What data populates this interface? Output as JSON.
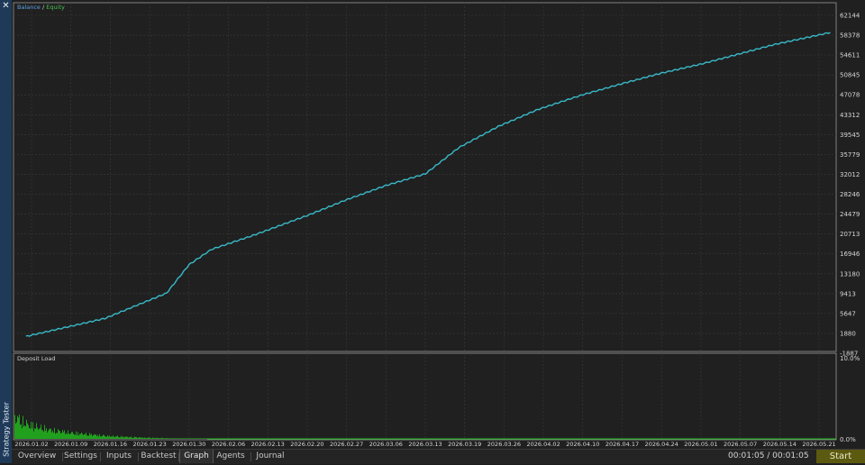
{
  "window": {
    "side_title": "Strategy Tester",
    "close_glyph": "✕"
  },
  "legend": {
    "balance": "Balance",
    "separator": " / ",
    "equity": "Equity"
  },
  "deposit_load": {
    "title": "Deposit Load"
  },
  "tabs": [
    {
      "label": "Overview",
      "active": false
    },
    {
      "label": "Settings",
      "active": false
    },
    {
      "label": "Inputs",
      "active": false
    },
    {
      "label": "Backtest",
      "active": false
    },
    {
      "label": "Graph",
      "active": true
    },
    {
      "label": "Agents",
      "active": false
    },
    {
      "label": "Journal",
      "active": false
    }
  ],
  "timer": "00:01:05 / 00:01:05",
  "start_label": "Start",
  "colors": {
    "balance_line": "#39b9c8",
    "equity_legend": "#49c24f",
    "deposit_bars": "#22c01e",
    "start_button": "#5b5a10"
  },
  "chart_data": [
    {
      "type": "line",
      "series": [
        {
          "name": "Balance",
          "x": [
            "2026-01-01",
            "2026-01-15",
            "2026-01-26",
            "2026-01-30",
            "2026-02-03",
            "2026-02-10",
            "2026-02-20",
            "2026-02-27",
            "2026-03-06",
            "2026-03-13",
            "2026-03-19",
            "2026-03-26",
            "2026-04-02",
            "2026-04-10",
            "2026-04-17",
            "2026-04-24",
            "2026-05-01",
            "2026-05-07",
            "2026-05-14",
            "2026-05-21",
            "2026-05-24"
          ],
          "values": [
            1300,
            4700,
            9500,
            14900,
            17800,
            20300,
            24200,
            27200,
            29900,
            32100,
            37100,
            41100,
            44300,
            47100,
            49200,
            51200,
            52900,
            54600,
            56600,
            58200,
            58900
          ]
        }
      ],
      "y_ticks": [
        "62144",
        "58378",
        "54611",
        "50845",
        "47078",
        "43312",
        "39545",
        "35779",
        "32012",
        "28246",
        "24479",
        "20713",
        "16946",
        "13180",
        "9413",
        "5647",
        "1880",
        "-1887"
      ],
      "x_ticks": [
        "2026.01.02",
        "2026.01.09",
        "2026.01.16",
        "2026.01.23",
        "2026.01.30",
        "2026.02.06",
        "2026.02.13",
        "2026.02.20",
        "2026.02.27",
        "2026.03.06",
        "2026.03.13",
        "2026.03.19",
        "2026.03.26",
        "2026.04.02",
        "2026.04.10",
        "2026.04.17",
        "2026.04.24",
        "2026.05.01",
        "2026.05.07",
        "2026.05.14",
        "2026.05.21"
      ],
      "ylim": [
        -1887,
        62144
      ],
      "grid": true,
      "legend": "top-left"
    },
    {
      "type": "bar",
      "title": "Deposit Load",
      "y_ticks": [
        "10.0%",
        "0.0%"
      ],
      "ylim": [
        0,
        10
      ],
      "series": [
        {
          "name": "Deposit Load",
          "values": [
            3.6,
            2.9,
            2.4,
            2.1,
            1.9,
            1.6,
            1.4,
            1.3,
            1.1,
            1.0,
            0.9,
            0.8,
            0.7,
            0.6,
            0.5,
            0.45,
            0.4,
            0.35,
            0.3,
            0.25,
            0.2,
            0.18,
            0.15,
            0.12,
            0.1,
            0.08,
            0.06,
            0.05,
            0.04,
            0.03
          ]
        }
      ],
      "grid": true
    }
  ]
}
